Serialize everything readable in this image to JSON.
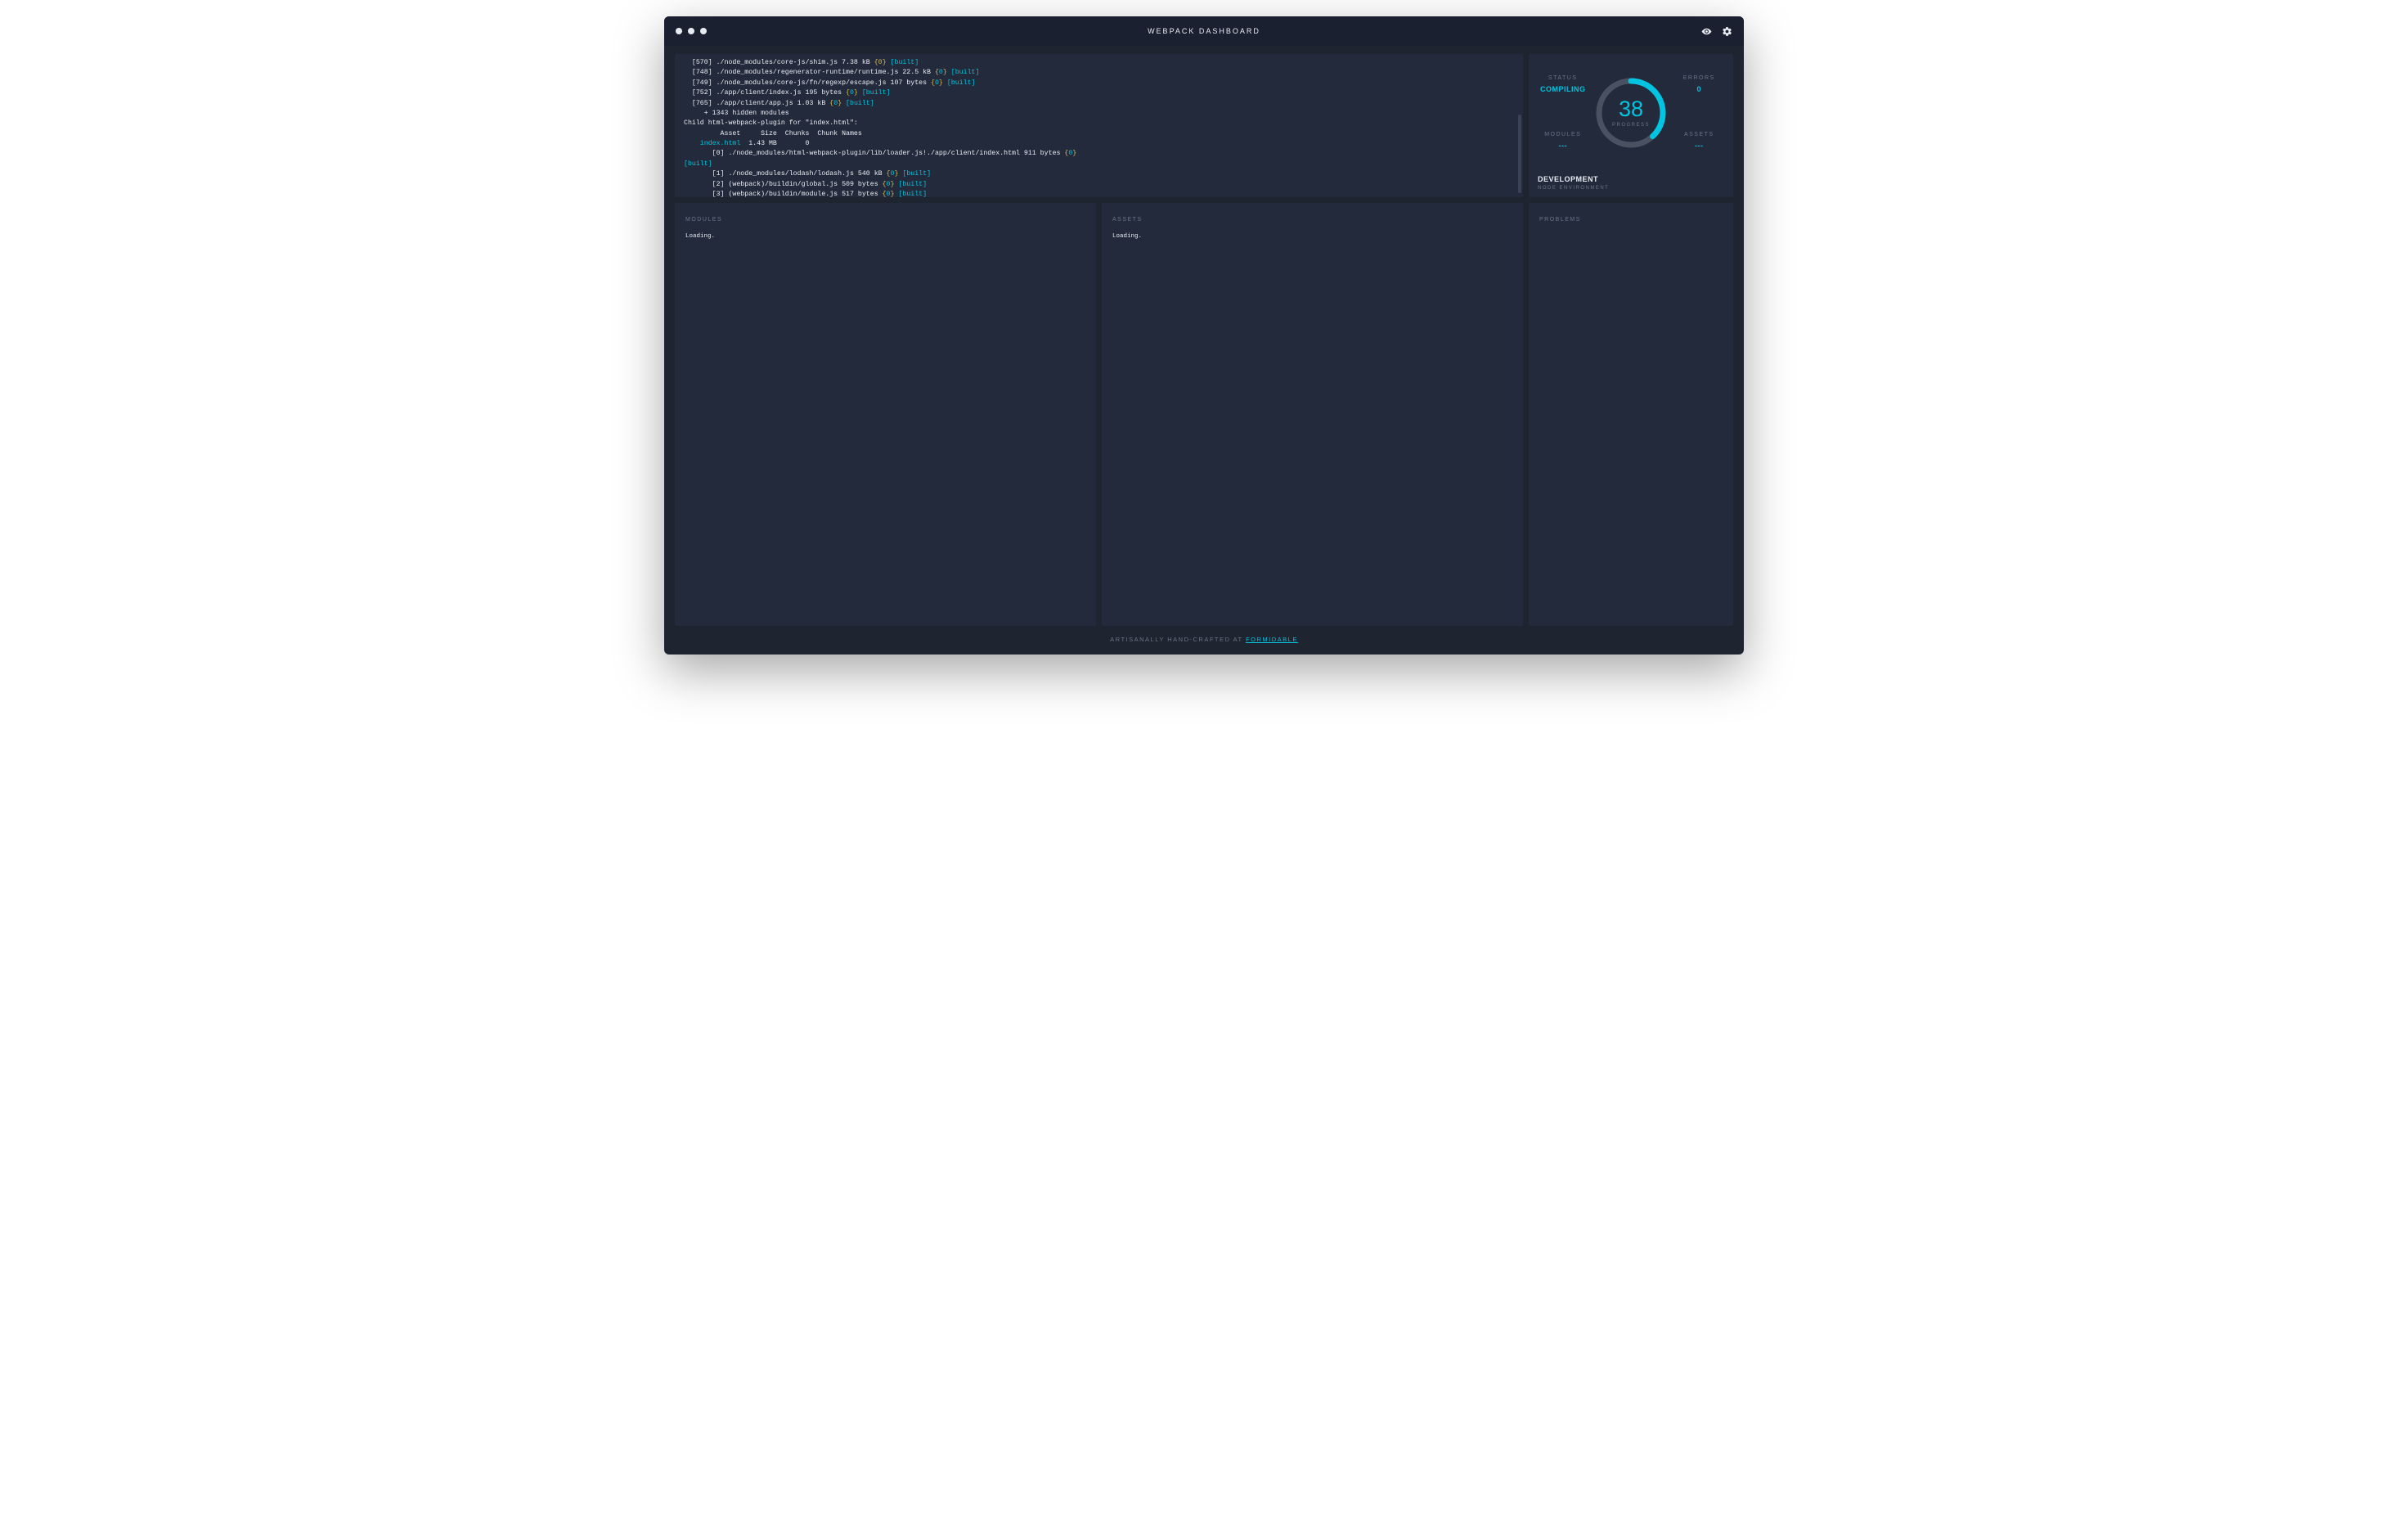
{
  "header": {
    "title": "WEBPACK DASHBOARD"
  },
  "log_lines": [
    [
      [
        "  [570] "
      ],
      [
        "./node_modules/core-js/shim.js 7.38 kB "
      ],
      [
        "{",
        "yel"
      ],
      [
        "0",
        "yel"
      ],
      [
        "}",
        "yel"
      ],
      [
        " "
      ],
      [
        "[built]",
        "acc"
      ]
    ],
    [
      [
        "  [748] "
      ],
      [
        "./node_modules/regenerator-runtime/runtime.js 22.5 kB "
      ],
      [
        "{",
        "yel"
      ],
      [
        "0",
        "acc"
      ],
      [
        "}",
        "yel"
      ],
      [
        " "
      ],
      [
        "[built]",
        "acc"
      ]
    ],
    [
      [
        "  [749] "
      ],
      [
        "./node_modules/core-js/fn/regexp/escape.js 107 bytes "
      ],
      [
        "{",
        "yel"
      ],
      [
        "0",
        "acc"
      ],
      [
        "}",
        "yel"
      ],
      [
        " "
      ],
      [
        "[built]",
        "acc"
      ]
    ],
    [
      [
        "  [752] "
      ],
      [
        "./app/client/index.js 195 bytes "
      ],
      [
        "{",
        "yel"
      ],
      [
        "0",
        "acc"
      ],
      [
        "}",
        "yel"
      ],
      [
        " "
      ],
      [
        "[built]",
        "acc"
      ]
    ],
    [
      [
        "  [765] "
      ],
      [
        "./app/client/app.js 1.03 kB "
      ],
      [
        "{",
        "yel"
      ],
      [
        "0",
        "acc"
      ],
      [
        "}",
        "yel"
      ],
      [
        " "
      ],
      [
        "[built]",
        "acc"
      ]
    ],
    [
      [
        "     + 1343 hidden modules"
      ]
    ],
    [
      [
        "Child html-webpack-plugin for \"index.html\":"
      ]
    ],
    [
      [
        "         Asset     Size  Chunks  Chunk Names"
      ]
    ],
    [
      [
        "    index.html",
        "acc"
      ],
      [
        "  1.43 MB       0"
      ]
    ],
    [
      [
        "       [0] "
      ],
      [
        "./node_modules/html-webpack-plugin/lib/loader.js!./app/client/index.html 911 bytes "
      ],
      [
        "{",
        "yel"
      ],
      [
        "0",
        "acc"
      ],
      [
        "}",
        "yel"
      ]
    ],
    [
      [
        "[built]",
        "acc"
      ]
    ],
    [
      [
        "       [1] "
      ],
      [
        "./node_modules/lodash/lodash.js 540 kB "
      ],
      [
        "{",
        "yel"
      ],
      [
        "0",
        "acc"
      ],
      [
        "}",
        "yel"
      ],
      [
        " "
      ],
      [
        "[built]",
        "acc"
      ]
    ],
    [
      [
        "       [2] "
      ],
      [
        "(webpack)/buildin/global.js 509 bytes "
      ],
      [
        "{",
        "yel"
      ],
      [
        "0",
        "acc"
      ],
      [
        "}",
        "yel"
      ],
      [
        " "
      ],
      [
        "[built]",
        "acc"
      ]
    ],
    [
      [
        "       [3] "
      ],
      [
        "(webpack)/buildin/module.js 517 bytes "
      ],
      [
        "{",
        "yel"
      ],
      [
        "0",
        "acc"
      ],
      [
        "}",
        "yel"
      ],
      [
        " "
      ],
      [
        "[built]",
        "acc"
      ]
    ]
  ],
  "status": {
    "status_label": "STATUS",
    "status_value": "COMPILING",
    "errors_label": "ERRORS",
    "errors_value": "0",
    "modules_label": "MODULES",
    "modules_value": "---",
    "assets_label": "ASSETS",
    "assets_value": "---",
    "progress_label": "PROGRESS",
    "progress_value": 38
  },
  "env": {
    "name": "DEVELOPMENT",
    "sub": "NODE ENVIRONMENT"
  },
  "panels": {
    "modules": {
      "title": "MODULES",
      "body": "Loading."
    },
    "assets": {
      "title": "ASSETS",
      "body": "Loading."
    },
    "problems": {
      "title": "PROBLEMS",
      "body": ""
    }
  },
  "footer": {
    "prefix": "ARTISANALLY HAND-CRAFTED AT ",
    "link_text": "FORMIDABLE"
  },
  "colors": {
    "accent": "#00c4e0",
    "ring_bg": "#4a5262"
  }
}
